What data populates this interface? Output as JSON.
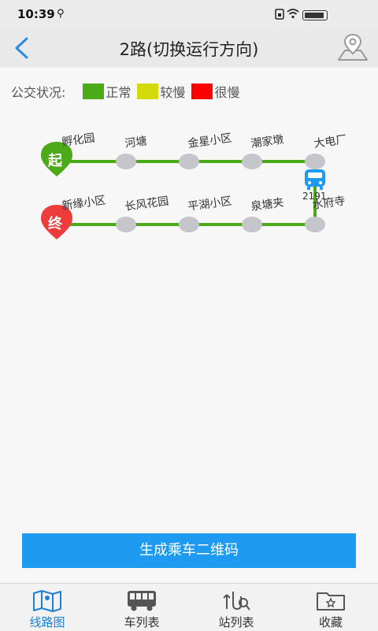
{
  "status_bar": {
    "time": "10:39",
    "usb_symbol": "⚲"
  },
  "header": {
    "title": "2路(切换运行方向)"
  },
  "legend": {
    "label": "公交状况:",
    "items": [
      {
        "label": "正常",
        "color": "#4caa18"
      },
      {
        "label": "较慢",
        "color": "#d4d90a"
      },
      {
        "label": "很慢",
        "color": "#ff0000"
      }
    ]
  },
  "route": {
    "start_badge": "起",
    "end_badge": "终",
    "top_row": [
      "孵化园",
      "河塘",
      "金星小区",
      "潮家墩",
      "大电厂"
    ],
    "bottom_row": [
      "新缘小区",
      "长风花园",
      "平湖小区",
      "泉塘夹",
      "水府寺"
    ],
    "bus_number": "2191",
    "line_color": "#4caa18",
    "stop_color": "#c4c6cc"
  },
  "actions": {
    "qr_button": "生成乘车二维码"
  },
  "tabs": [
    {
      "label": "线路图",
      "icon": "map-icon",
      "active": true
    },
    {
      "label": "车列表",
      "icon": "bus-icon",
      "active": false
    },
    {
      "label": "站列表",
      "icon": "station-search-icon",
      "active": false
    },
    {
      "label": "收藏",
      "icon": "favorites-folder-icon",
      "active": false
    }
  ]
}
